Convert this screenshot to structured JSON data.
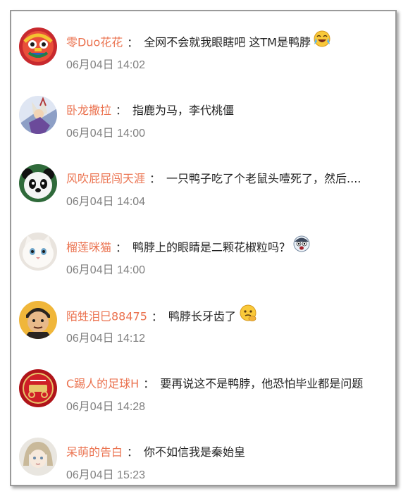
{
  "comments": [
    {
      "username": "零Duo花花",
      "separator": "：",
      "text": "全网不会就我眼瞎吧 这TM是鸭脖",
      "time": "06月04日 14:02",
      "avatar": "lion-dance-avatar-icon",
      "emoji": "crying-laughing-emoji-icon"
    },
    {
      "username": "卧龙撒拉",
      "separator": "：",
      "text": "指鹿为马，李代桃僵",
      "time": "06月04日 14:00",
      "avatar": "anime-character-avatar-icon",
      "emoji": ""
    },
    {
      "username": "风吹屁屁闯天涯",
      "separator": "：",
      "text": "一只鸭子吃了个老鼠头噎死了，然后....",
      "time": "06月04日 14:04",
      "avatar": "panda-avatar-icon",
      "emoji": ""
    },
    {
      "username": "榴莲咪猫",
      "separator": "：",
      "text": "鸭脖上的眼睛是二颗花椒粒吗？",
      "time": "06月04日 14:00",
      "avatar": "white-cat-avatar-icon",
      "emoji": "scared-face-emoji-icon"
    },
    {
      "username": "陌甡泪巳88475",
      "separator": "：",
      "text": "鸭脖长牙齿了",
      "time": "06月04日 14:12",
      "avatar": "cartoon-man-avatar-icon",
      "emoji": "thinking-face-emoji-icon"
    },
    {
      "username": "C踢人的足球H",
      "separator": "：",
      "text": "要再说这不是鸭脖，他恐怕毕业都是问题",
      "time": "06月04日 14:28",
      "avatar": "arsenal-badge-avatar-icon",
      "emoji": ""
    },
    {
      "username": "呆萌的告白",
      "separator": "：",
      "text": "你不如信我是秦始皇",
      "time": "06月04日 15:23",
      "avatar": "anime-girl-avatar-icon",
      "emoji": ""
    }
  ]
}
